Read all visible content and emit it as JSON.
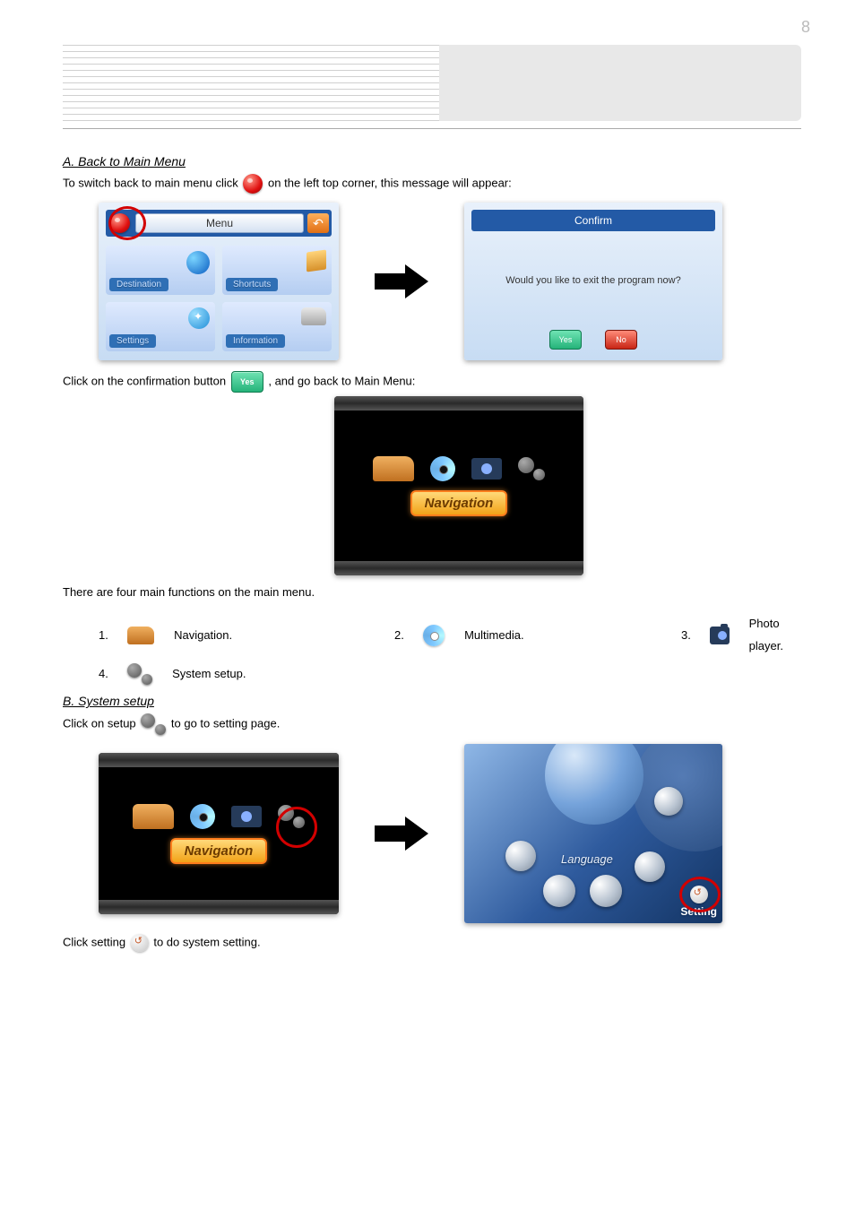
{
  "page": {
    "number": "8"
  },
  "sections": {
    "main_menu": {
      "title": "A. Back to Main Menu",
      "step1_pre": "To switch back to main menu click",
      "step1_post": "on the left top corner, this message will appear:",
      "step2_pre": "Click on the confirmation button ",
      "step2_post": " , and go back to Main Menu:",
      "four_functions": "There are four main functions on the main menu.",
      "functions": [
        {
          "num": "1.",
          "label": "Navigation."
        },
        {
          "num": "2.",
          "label": "Multimedia."
        },
        {
          "num": "3.",
          "label": "Photo player."
        },
        {
          "num": "4.",
          "label": "System setup."
        }
      ]
    },
    "setup": {
      "title": "B. System setup",
      "step1_pre": "Click on setup ",
      "step1_post": " to go to setting page.",
      "step2_pre": "Click setting ",
      "step2_post": " to do system setting."
    }
  },
  "screenshots": {
    "menu": {
      "title": "Menu",
      "items": [
        "Destination",
        "Shortcuts",
        "Settings",
        "Information"
      ]
    },
    "confirm": {
      "title": "Confirm",
      "message": "Would you like to exit the program now?",
      "yes": "Yes",
      "no": "No"
    },
    "mainmenu": {
      "label": "Navigation"
    },
    "settings": {
      "language": "Language",
      "setting": "Setting"
    }
  }
}
